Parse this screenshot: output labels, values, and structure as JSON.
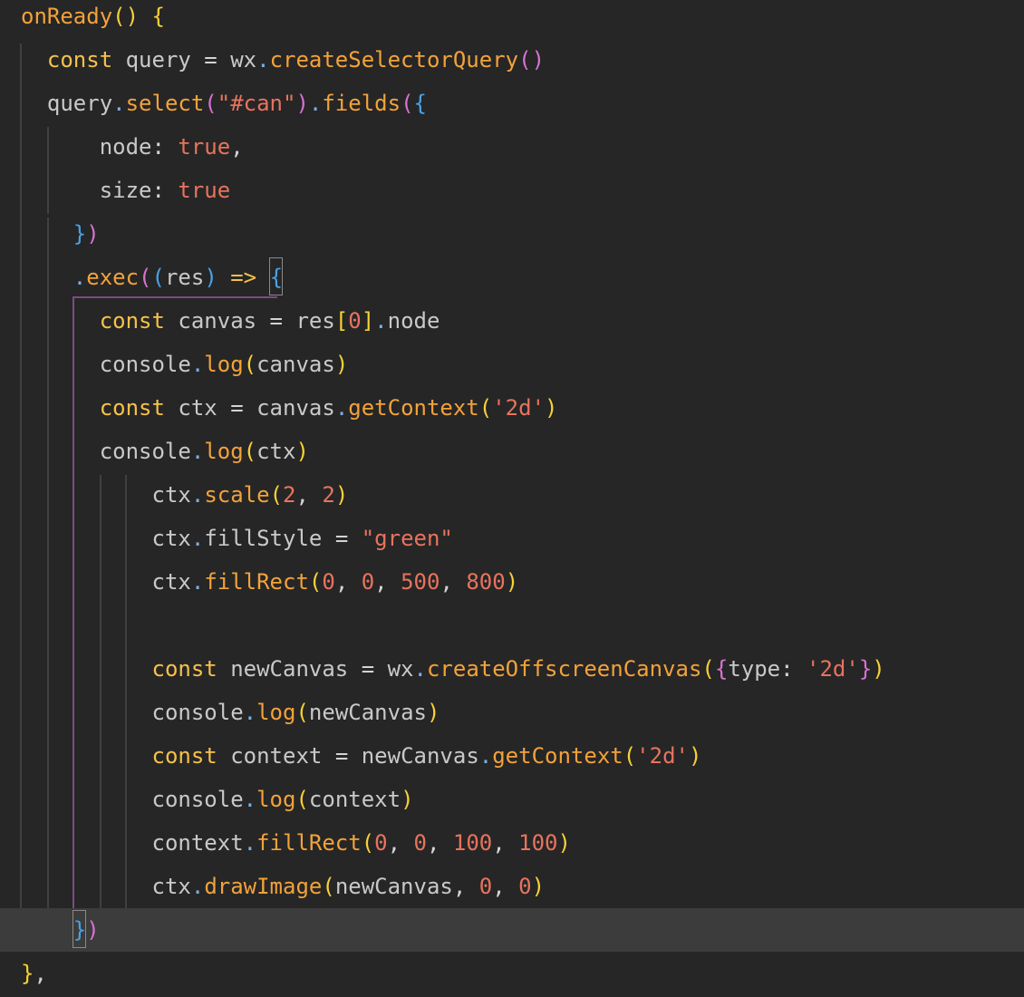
{
  "editor": {
    "language": "javascript",
    "theme_colors": {
      "background": "#262626",
      "current_line": "#3c3c3c",
      "keyword": "#f7c14a",
      "function": "#f3a23a",
      "string": "#e8735e",
      "number": "#e8735e",
      "identifier": "#c9c9c9",
      "punctuation": "#7cb0e3",
      "bracket_level_1": "#f8d136",
      "bracket_level_2": "#d673d1",
      "bracket_level_3": "#49a2e6",
      "active_indent_guide": "#7d4a86"
    },
    "current_line_index": 21,
    "lines": [
      "onReady() {",
      "  const query = wx.createSelectorQuery()",
      "  query.select(\"#can\").fields({",
      "      node: true,",
      "      size: true",
      "    })",
      "    .exec((res) => {",
      "      const canvas = res[0].node",
      "      console.log(canvas)",
      "      const ctx = canvas.getContext('2d')",
      "      console.log(ctx)",
      "          ctx.scale(2, 2)",
      "          ctx.fillStyle = \"green\"",
      "          ctx.fillRect(0, 0, 500, 800)",
      "",
      "          const newCanvas = wx.createOffscreenCanvas({type: '2d'})",
      "          console.log(newCanvas)",
      "          const context = newCanvas.getContext('2d')",
      "          console.log(context)",
      "          context.fillRect(0, 0, 100, 100)",
      "          ctx.drawImage(newCanvas, 0, 0)",
      "    })",
      "},"
    ]
  }
}
